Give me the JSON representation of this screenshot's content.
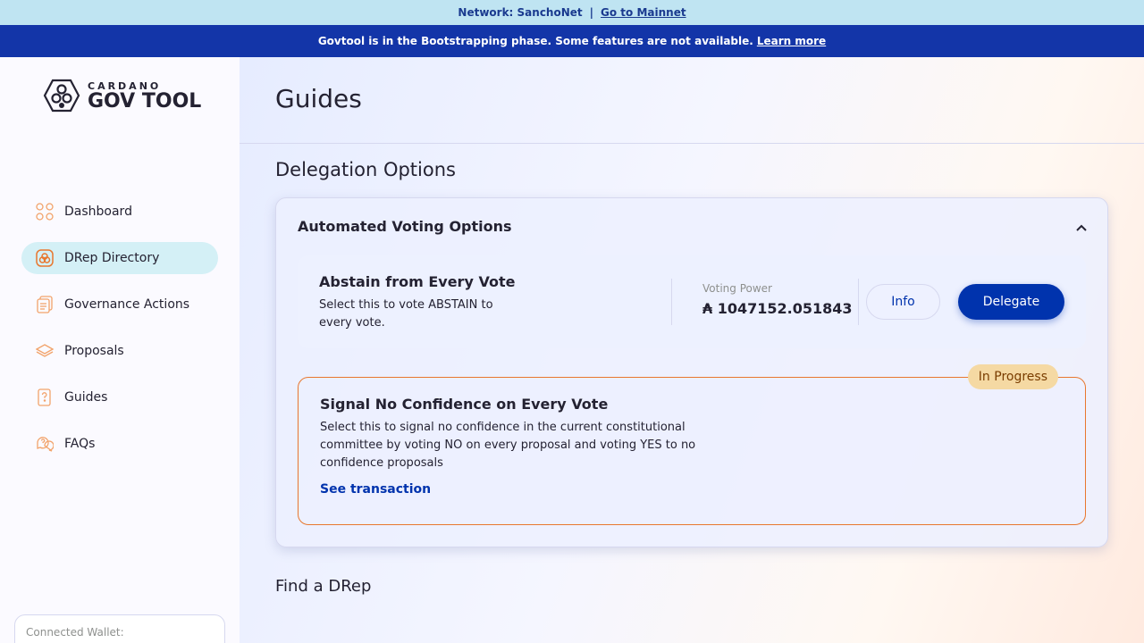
{
  "network_bar": {
    "network_label": "Network: SanchoNet",
    "separator": "|",
    "mainnet_link": "Go to Mainnet"
  },
  "bootstrap_bar": {
    "message": "Govtool is in the Bootstrapping phase. Some features are not available.",
    "learn_more": "Learn more"
  },
  "logo": {
    "small": "CARDANO",
    "big": "GOV TOOL"
  },
  "sidebar": {
    "items": [
      {
        "label": "Dashboard",
        "icon": "dashboard-icon",
        "active": false
      },
      {
        "label": "DRep Directory",
        "icon": "drep-directory-icon",
        "active": true
      },
      {
        "label": "Governance Actions",
        "icon": "governance-actions-icon",
        "active": false
      },
      {
        "label": "Proposals",
        "icon": "proposals-icon",
        "active": false
      },
      {
        "label": "Guides",
        "icon": "guides-icon",
        "active": false
      },
      {
        "label": "FAQs",
        "icon": "faqs-icon",
        "active": false
      }
    ],
    "wallet_label": "Connected Wallet:"
  },
  "page": {
    "title": "Guides",
    "section_title": "Delegation Options",
    "find_title": "Find a DRep"
  },
  "automated": {
    "title": "Automated Voting Options",
    "abstain": {
      "title": "Abstain from Every Vote",
      "description": "Select this to vote ABSTAIN to every vote.",
      "voting_power_label": "Voting Power",
      "voting_power_value": "₳ 1047152.051843",
      "info_button": "Info",
      "delegate_button": "Delegate"
    },
    "no_confidence": {
      "badge": "In Progress",
      "title": "Signal No Confidence on Every Vote",
      "description": "Select this to signal no confidence in the current constitutional committee by voting NO on every proposal and voting YES to no confidence proposals",
      "link": "See transaction"
    }
  },
  "colors": {
    "accent": "#0033ad",
    "bootstrap_bar": "#1335a8",
    "network_bar": "#bfe4f2",
    "in_progress_border": "#e8772e",
    "active_nav": "#d4f0f6",
    "icon_orange": "#f2a36b"
  }
}
